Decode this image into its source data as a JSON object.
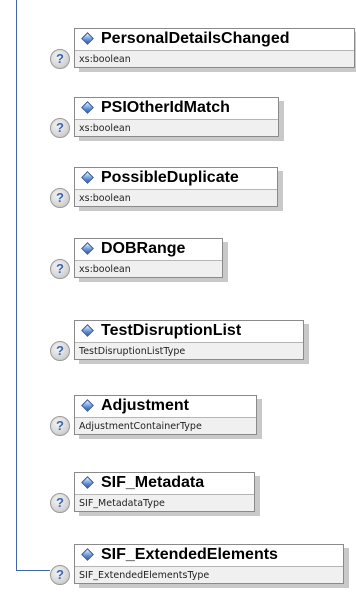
{
  "elements": [
    {
      "name": "PersonalDetailsChanged",
      "type": "xs:boolean",
      "help_icon": "question-icon",
      "element_icon": "diamond-icon"
    },
    {
      "name": "PSIOtherIdMatch",
      "type": "xs:boolean",
      "help_icon": "question-icon",
      "element_icon": "diamond-icon"
    },
    {
      "name": "PossibleDuplicate",
      "type": "xs:boolean",
      "help_icon": "question-icon",
      "element_icon": "diamond-icon"
    },
    {
      "name": "DOBRange",
      "type": "xs:boolean",
      "help_icon": "question-icon",
      "element_icon": "diamond-icon"
    },
    {
      "name": "TestDisruptionList",
      "type": "TestDisruptionListType",
      "help_icon": "question-icon",
      "element_icon": "diamond-icon"
    },
    {
      "name": "Adjustment",
      "type": "AdjustmentContainerType",
      "help_icon": "question-icon",
      "element_icon": "diamond-icon"
    },
    {
      "name": "SIF_Metadata",
      "type": "SIF_MetadataType",
      "help_icon": "question-icon",
      "element_icon": "diamond-icon"
    },
    {
      "name": "SIF_ExtendedElements",
      "type": "SIF_ExtendedElementsType",
      "help_icon": "question-icon",
      "element_icon": "diamond-icon"
    }
  ],
  "help_symbol": "?",
  "colors": {
    "connector": "#3f66a8",
    "box_border": "#8a8a8a",
    "type_background": "#f0f0f0"
  }
}
